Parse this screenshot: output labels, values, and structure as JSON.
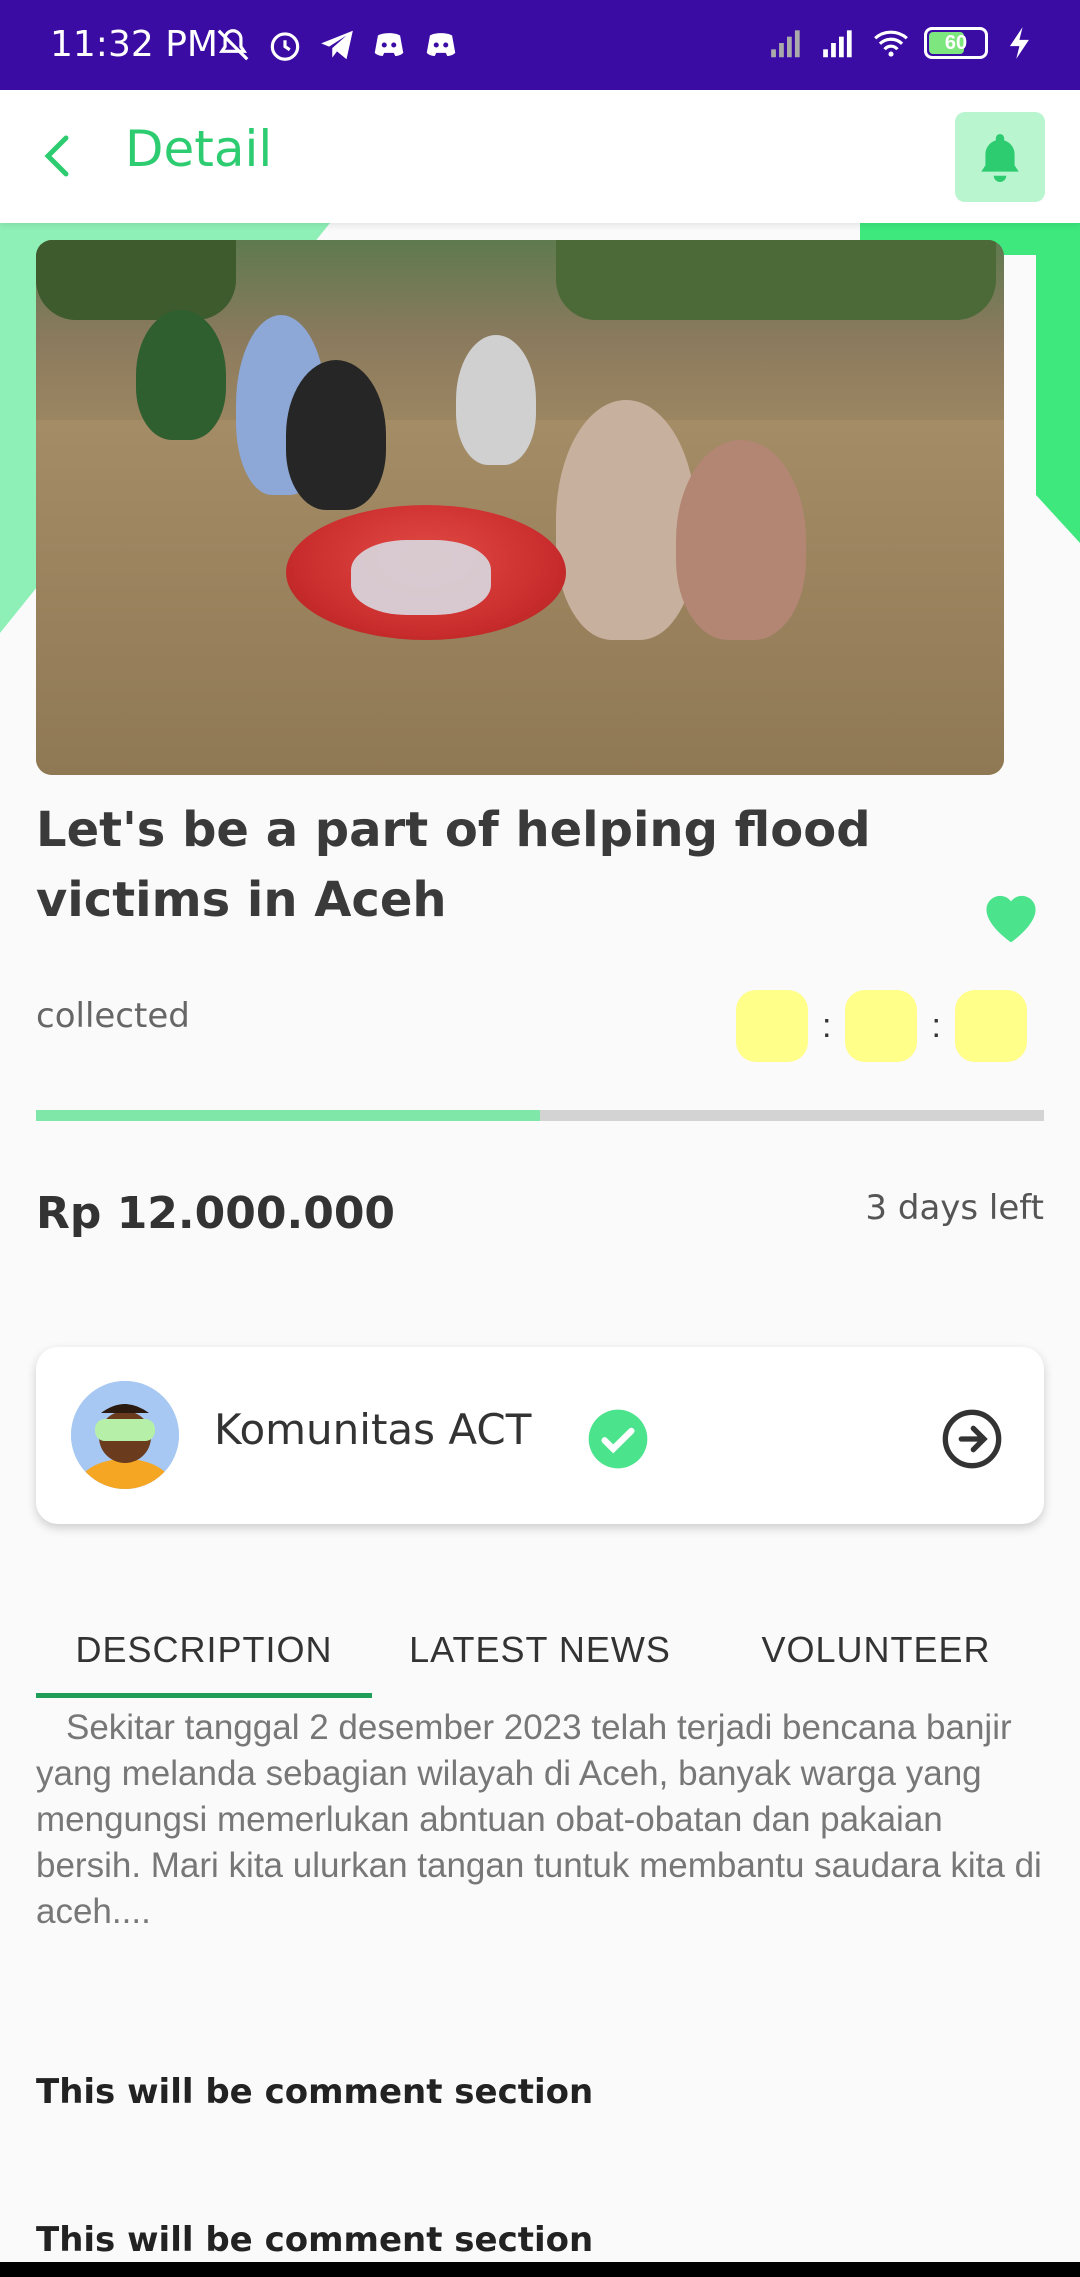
{
  "status_bar": {
    "time": "11:32 PM",
    "battery_level": "60",
    "left_icons": [
      "mute-bell-icon",
      "alarm-icon",
      "telegram-icon",
      "discord-icon",
      "discord-icon"
    ],
    "right_icons": [
      "signal-icon",
      "signal-icon",
      "wifi-icon",
      "battery-icon",
      "charging-icon"
    ]
  },
  "header": {
    "title": "Detail",
    "back_icon": "chevron-left-icon",
    "notification_icon": "bell-icon"
  },
  "campaign": {
    "title": "Let's be a part of helping flood victims in Aceh",
    "collected_label": "collected",
    "countdown_separator": ":",
    "progress": 0.5,
    "amount": "Rp 12.000.000",
    "days_left": "3 days left",
    "favorite_icon": "heart-icon"
  },
  "organizer": {
    "name": "Komunitas ACT",
    "verified_icon": "check-circle-icon",
    "arrow_icon": "arrow-right-circle-icon"
  },
  "tabs": {
    "items": [
      {
        "label": "DESCRIPTION"
      },
      {
        "label": "LATEST NEWS"
      },
      {
        "label": "VOLUNTEER"
      }
    ],
    "active": 0
  },
  "description": "Sekitar tanggal 2 desember 2023 telah terjadi bencana banjir yang melanda sebagian wilayah di Aceh, banyak warga yang mengungsi memerlukan abntuan obat-obatan dan pakaian bersih. Mari kita ulurkan tangan tuntuk membantu saudara kita di aceh....",
  "comments": [
    {
      "text": "This will be comment section"
    },
    {
      "text": "This will be comment section"
    }
  ],
  "colors": {
    "status_bar": "#3a0ca3",
    "accent_green": "#2ecc71",
    "countdown_box": "#ffff8a",
    "progress_fill": "#7fe8a8",
    "tab_indicator": "#1e9e57"
  }
}
